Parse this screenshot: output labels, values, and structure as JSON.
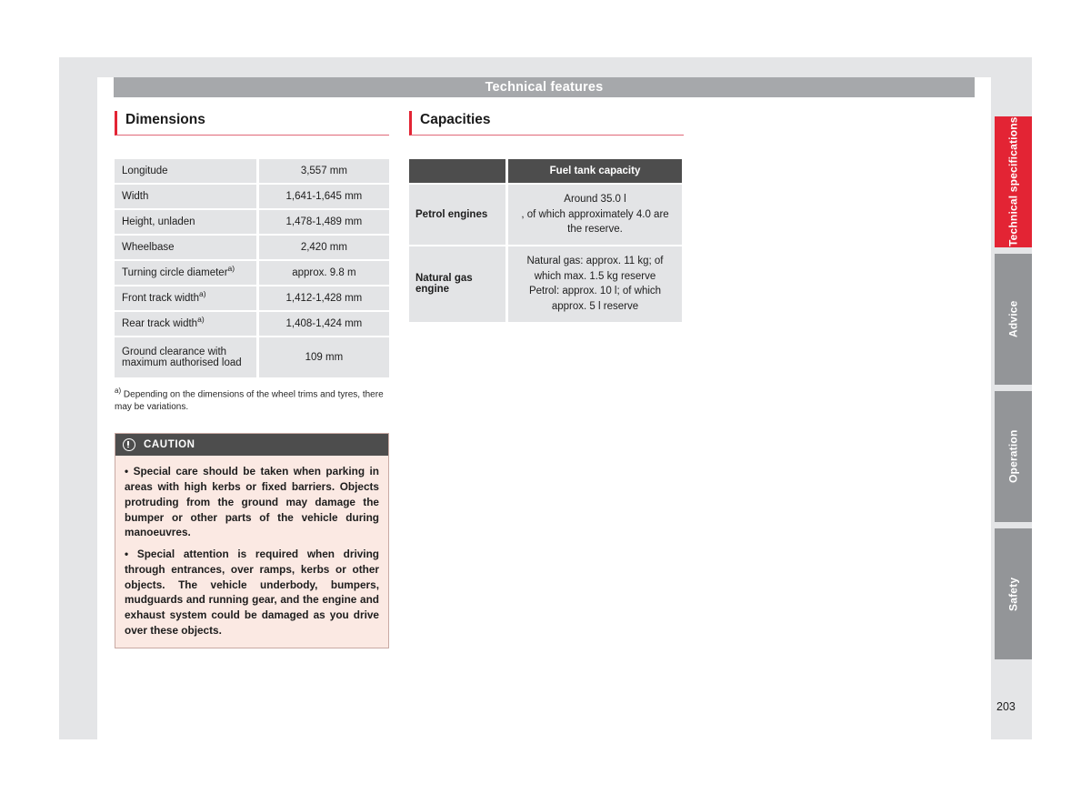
{
  "header": {
    "title": "Technical features"
  },
  "page_number": "203",
  "left_column": {
    "section_title": "Dimensions",
    "table": {
      "rows": [
        {
          "label": "Longitude",
          "footnote": "",
          "value": "3,557 mm"
        },
        {
          "label": "Width",
          "footnote": "",
          "value": "1,641-1,645 mm"
        },
        {
          "label": "Height, unladen",
          "footnote": "",
          "value": "1,478-1,489 mm"
        },
        {
          "label": "Wheelbase",
          "footnote": "",
          "value": "2,420 mm"
        },
        {
          "label": "Turning circle diameter",
          "footnote": "a)",
          "value": "approx. 9.8 m"
        },
        {
          "label": "Front track width",
          "footnote": "a)",
          "value": "1,412-1,428 mm"
        },
        {
          "label": "Rear track width",
          "footnote": "a)",
          "value": "1,408-1,424 mm"
        },
        {
          "label": "Ground clearance with maximum authorised load",
          "footnote": "",
          "value": "109 mm"
        }
      ]
    },
    "footnote_marker": "a)",
    "footnote_text": "Depending on the dimensions of the wheel trims and tyres, there may be variations.",
    "caution": {
      "icon": "warning-circle-icon",
      "heading": "CAUTION",
      "paragraphs": [
        "• Special care should be taken when parking in areas with high kerbs or fixed barriers. Objects protruding from the ground may damage the bumper or other parts of the vehicle during manoeuvres.",
        "• Special attention is required when driving through entrances, over ramps, kerbs or other objects. The vehicle underbody, bumpers, mudguards and running gear, and the engine and exhaust system could be damaged as you drive over these objects."
      ]
    }
  },
  "right_column": {
    "section_title": "Capacities",
    "table": {
      "header": {
        "blank": "",
        "value_header": "Fuel tank capacity"
      },
      "rows": [
        {
          "label": "Petrol engines",
          "value": "Around 35.0 l\n, of which approximately 4.0 are the reserve."
        },
        {
          "label": "Natural gas engine",
          "value": "Natural gas: approx. 11 kg; of which max. 1.5 kg reserve\nPetrol: approx. 10 l; of which approx. 5 l reserve"
        }
      ]
    }
  },
  "tabs": [
    {
      "label": "Technical specifications",
      "active": true
    },
    {
      "label": "Advice",
      "active": false
    },
    {
      "label": "Operation",
      "active": false
    },
    {
      "label": "Safety",
      "active": false
    }
  ],
  "colors": {
    "accent_red": "#e32434",
    "tab_grey": "#939598",
    "header_grey": "#a6a8ab",
    "table_header_dark": "#4d4d4d",
    "table_cell_grey": "#e3e4e6",
    "caution_bg": "#fbe9e3",
    "page_bg": "#e4e5e7"
  }
}
